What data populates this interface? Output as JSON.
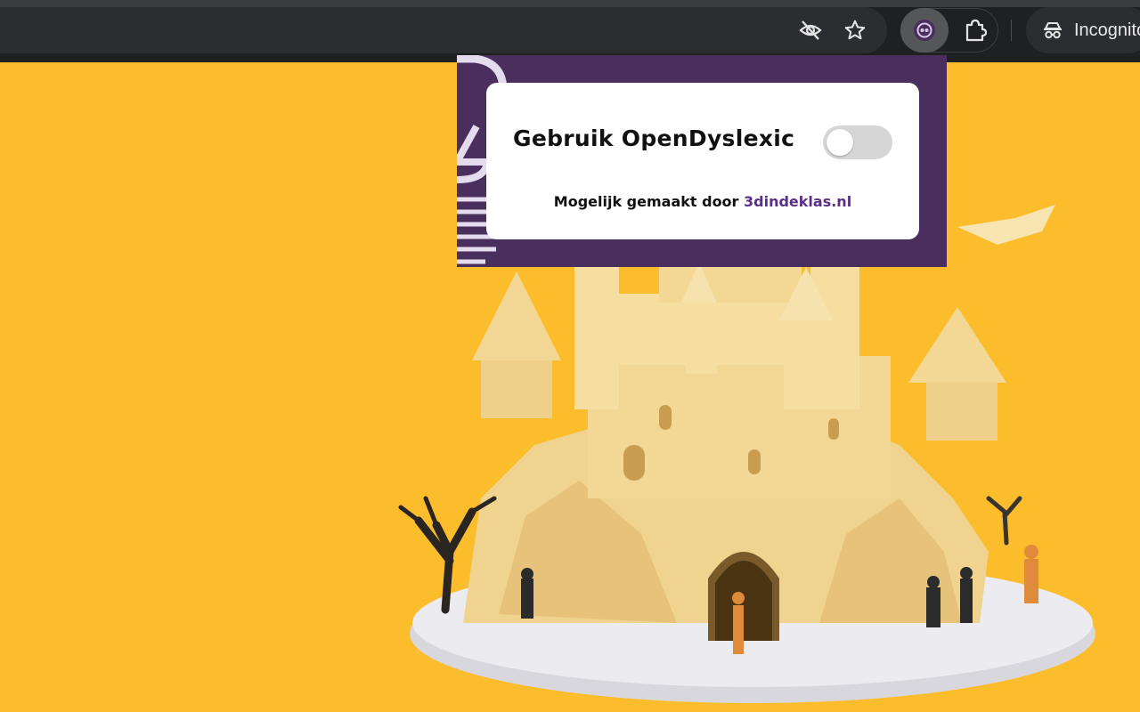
{
  "browser": {
    "toolbar_icons": [
      "eye-off-icon",
      "star-icon",
      "extension-opendyslexic-icon",
      "puzzle-icon"
    ],
    "incognito_label": "Incognito",
    "colors": {
      "toolbar": "#1f2022",
      "omnibox": "#2c2d30"
    }
  },
  "page": {
    "background_color": "#fbbd2c",
    "image_description_icon": "castle-illustration"
  },
  "popup": {
    "toggle_label": "Gebruik OpenDyslexic",
    "toggle_state": "off",
    "credit_prefix": "Mogelijk gemaakt door",
    "credit_link": "3dindeklas.nl",
    "colors": {
      "frame": "#4a2e5d",
      "card": "#ffffff",
      "link": "#5b2f86",
      "toggle_off": "#d6d6d6"
    }
  }
}
